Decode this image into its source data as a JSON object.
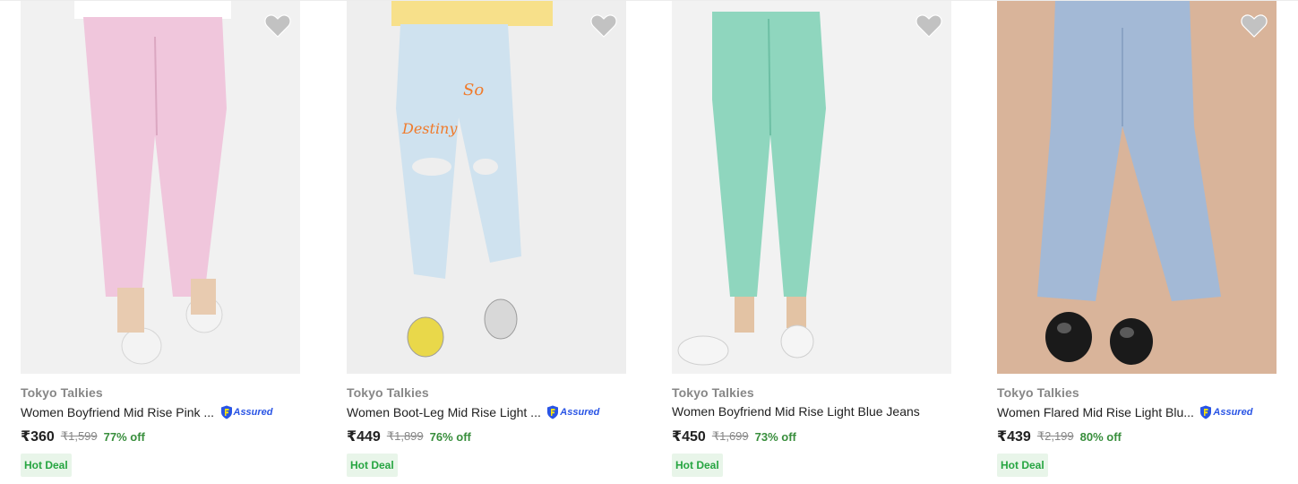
{
  "products": [
    {
      "brand": "Tokyo Talkies",
      "title": "Women Boyfriend Mid Rise Pink ...",
      "assured": true,
      "assured_label": "Assured",
      "price": "₹360",
      "mrp": "₹1,599",
      "discount": "77% off",
      "deal_badge": "Hot Deal",
      "image_bg": "#f1f1f1",
      "jeans_color": "#f0c6dc",
      "shoe_color": "#f3f3f3"
    },
    {
      "brand": "Tokyo Talkies",
      "title": "Women Boot-Leg Mid Rise Light ...",
      "assured": true,
      "assured_label": "Assured",
      "price": "₹449",
      "mrp": "₹1,899",
      "discount": "76% off",
      "deal_badge": "Hot Deal",
      "image_bg": "#eeeeee",
      "jeans_color": "#cfe2ef",
      "shoe_color": "#e9d84a"
    },
    {
      "brand": "Tokyo Talkies",
      "title": "Women Boyfriend Mid Rise Light Blue Jeans",
      "assured": false,
      "assured_label": "",
      "price": "₹450",
      "mrp": "₹1,699",
      "discount": "73% off",
      "deal_badge": "Hot Deal",
      "image_bg": "#f2f2f2",
      "jeans_color": "#8fd6be",
      "shoe_color": "#f5f5f5"
    },
    {
      "brand": "Tokyo Talkies",
      "title": "Women Flared Mid Rise Light Blu...",
      "assured": true,
      "assured_label": "Assured",
      "price": "₹439",
      "mrp": "₹2,199",
      "discount": "80% off",
      "deal_badge": "Hot Deal",
      "image_bg": "#d9b49a",
      "jeans_color": "#a3b9d6",
      "shoe_color": "#1a1a1a"
    }
  ],
  "icons": {
    "wishlist": "heart-icon",
    "assured": "flipkart-assured-icon"
  },
  "colors": {
    "price_text": "#212121",
    "discount_green": "#388e3c",
    "deal_bg": "#e8f5e9",
    "deal_text": "#26a541",
    "assured_blue": "#2a55e5",
    "wishlist_grey": "#c2c2c2"
  }
}
